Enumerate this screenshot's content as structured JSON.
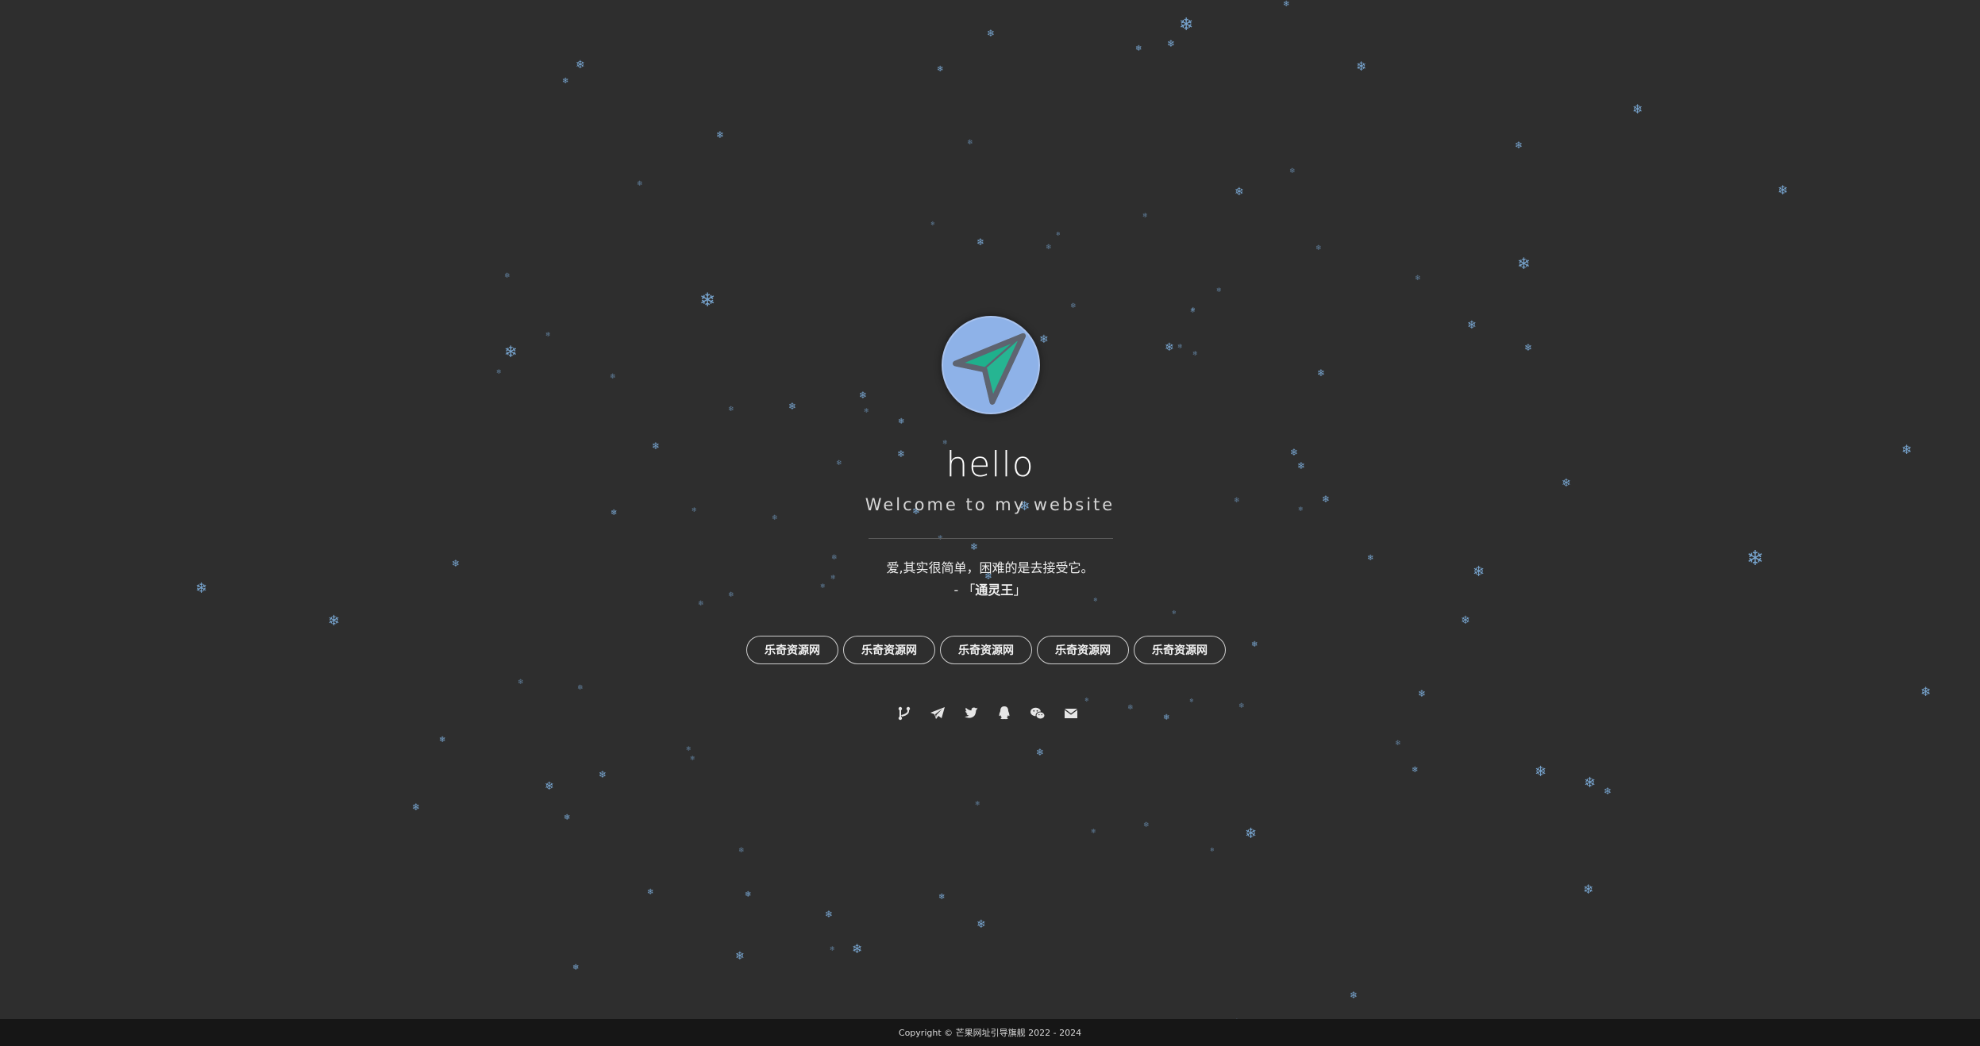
{
  "profile": {
    "avatar_icon": "paper-plane-icon",
    "title": "hello",
    "subtitle": "Welcome to my website"
  },
  "quote": {
    "text": "爱,其实很简单，困难的是去接受它。",
    "author_prefix": "- 「",
    "author": "通灵王",
    "author_suffix": "」"
  },
  "links": [
    {
      "label": "乐奇资源网"
    },
    {
      "label": "乐奇资源网"
    },
    {
      "label": "乐奇资源网"
    },
    {
      "label": "乐奇资源网"
    },
    {
      "label": "乐奇资源网"
    }
  ],
  "social": [
    {
      "name": "github-icon"
    },
    {
      "name": "telegram-icon"
    },
    {
      "name": "twitter-icon"
    },
    {
      "name": "qq-icon"
    },
    {
      "name": "wechat-icon"
    },
    {
      "name": "email-icon"
    }
  ],
  "footer": {
    "text": "Copyright © 芒果网址引导旗舰 2022 - 2024"
  },
  "colors": {
    "background": "#2e2e2e",
    "snowflake": "#7fb1e0",
    "avatar_bg": "#8eb2e8",
    "plane_fill": "#20b38e",
    "footer_bg": "#161616"
  }
}
